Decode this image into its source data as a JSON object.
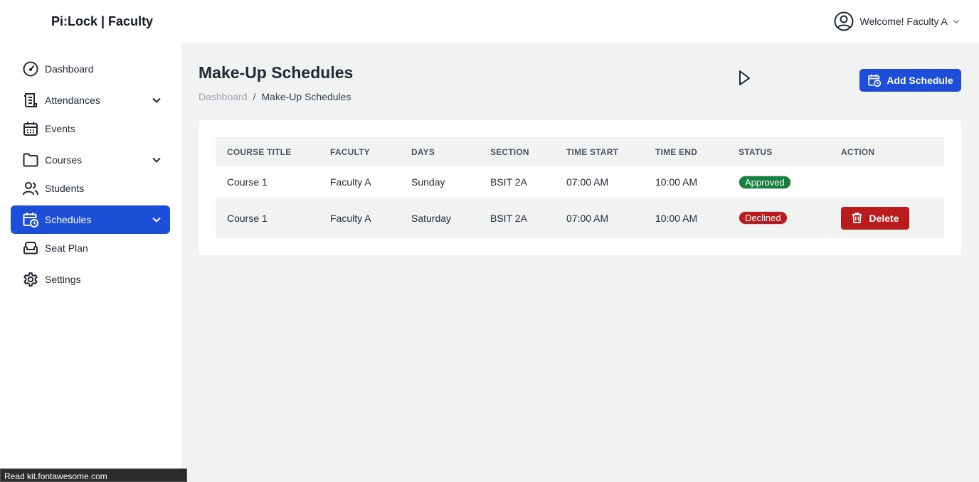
{
  "app": {
    "brand": "Pi:Lock | Faculty"
  },
  "user": {
    "welcome": "Welcome! Faculty A"
  },
  "sidebar": {
    "items": [
      {
        "label": "Dashboard",
        "icon": "gauge-icon"
      },
      {
        "label": "Attendances",
        "icon": "scroll-icon",
        "expandable": true
      },
      {
        "label": "Events",
        "icon": "calendar-icon"
      },
      {
        "label": "Courses",
        "icon": "folder-icon",
        "expandable": true
      },
      {
        "label": "Students",
        "icon": "users-icon"
      },
      {
        "label": "Schedules",
        "icon": "calendar-clock-icon",
        "expandable": true,
        "active": true
      },
      {
        "label": "Seat Plan",
        "icon": "couch-icon"
      },
      {
        "label": "Settings",
        "icon": "gear-icon"
      }
    ]
  },
  "page": {
    "title": "Make-Up Schedules",
    "breadcrumb": {
      "root": "Dashboard",
      "separator": "/",
      "current": "Make-Up Schedules"
    },
    "add_button": "Add Schedule"
  },
  "table": {
    "headers": [
      "COURSE TITLE",
      "FACULTY",
      "DAYS",
      "SECTION",
      "TIME START",
      "TIME END",
      "STATUS",
      "ACTION"
    ],
    "rows": [
      {
        "course": "Course 1",
        "faculty": "Faculty A",
        "days": "Sunday",
        "section": "BSIT 2A",
        "time_start": "07:00 AM",
        "time_end": "10:00 AM",
        "status": "Approved",
        "action": ""
      },
      {
        "course": "Course 1",
        "faculty": "Faculty A",
        "days": "Saturday",
        "section": "BSIT 2A",
        "time_start": "07:00 AM",
        "time_end": "10:00 AM",
        "status": "Declined",
        "action": "Delete"
      }
    ]
  },
  "statusbar": {
    "text": "Read kit.fontawesome.com"
  },
  "colors": {
    "accent": "#1d4ed8",
    "approved": "#15803d",
    "declined": "#b91c1c",
    "content_bg": "#f1f2f2"
  }
}
